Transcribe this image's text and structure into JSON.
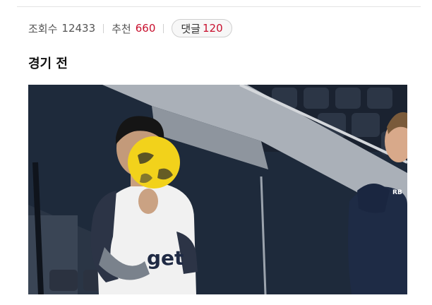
{
  "meta": {
    "views_label": "조회수",
    "views_count": "12433",
    "recommend_label": "추천",
    "recommend_count": "660",
    "comments_label": "댓글",
    "comments_count": "120"
  },
  "section": {
    "title": "경기 전"
  },
  "media": {
    "shirt_text": "get",
    "jacket_text": "RB"
  },
  "colors": {
    "accent_red": "#c8102e",
    "ball_yellow": "#f2d21b"
  }
}
